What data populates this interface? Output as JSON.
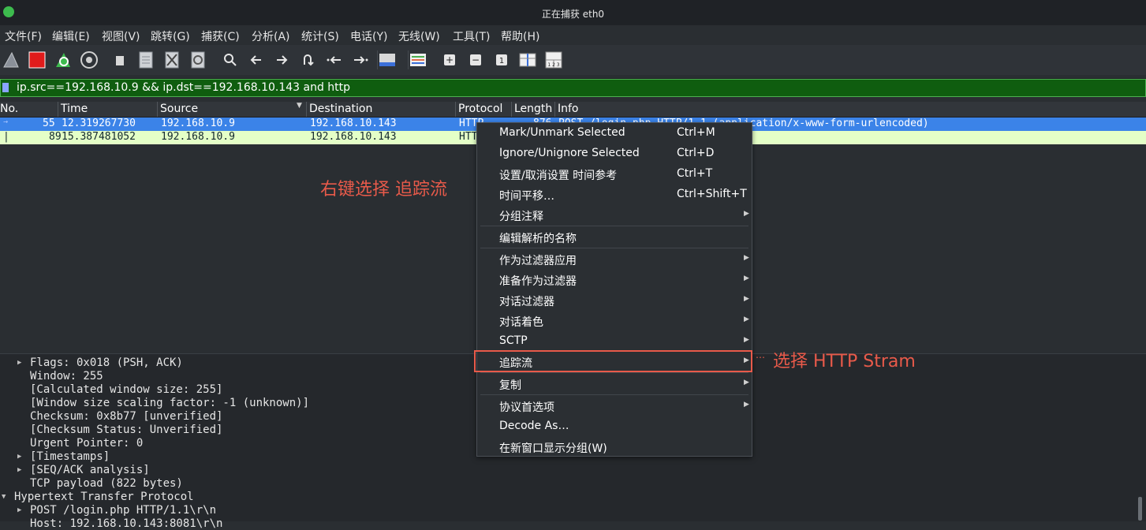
{
  "window": {
    "title": "正在捕获 eth0"
  },
  "menubar": [
    "文件(F)",
    "编辑(E)",
    "视图(V)",
    "跳转(G)",
    "捕获(C)",
    "分析(A)",
    "统计(S)",
    "电话(Y)",
    "无线(W)",
    "工具(T)",
    "帮助(H)"
  ],
  "toolbar": {
    "icons": [
      "shark-fin-icon",
      "stop-capture-icon",
      "restart-capture-icon",
      "capture-options-icon",
      "open-file-icon",
      "save-file-icon",
      "close-file-icon",
      "reload-file-icon",
      "find-packet-icon",
      "go-back-icon",
      "go-forward-icon",
      "go-to-packet-icon",
      "go-first-icon",
      "go-last-icon",
      "auto-scroll-icon",
      "colorize-icon",
      "zoom-in-icon",
      "zoom-out-icon",
      "normal-size-icon",
      "resize-columns-icon",
      "layout-icon"
    ],
    "zoom_in": "+",
    "zoom_out": "−",
    "normal_size": "1",
    "layout_label": "1 2 3"
  },
  "filter": {
    "value": "ip.src==192.168.10.9 && ip.dst==192.168.10.143 and http"
  },
  "columns": [
    "No.",
    "Time",
    "Source",
    "Destination",
    "Protocol",
    "Length",
    "Info"
  ],
  "packets": [
    {
      "no": "55",
      "time": "12.319267730",
      "source": "192.168.10.9",
      "destination": "192.168.10.143",
      "protocol": "HTTP",
      "length": "876",
      "info": "POST /login.php HTTP/1.1  (application/x-www-form-urlencoded)"
    },
    {
      "no": "89",
      "time": "15.387481052",
      "source": "192.168.10.9",
      "destination": "192.168.10.143",
      "protocol": "HTTP",
      "length": "",
      "info": ""
    }
  ],
  "annotations": {
    "right_click": "右键选择 追踪流",
    "select_stream": "选择 HTTP Stram"
  },
  "context_menu": [
    {
      "label": "Mark/Unmark Selected",
      "shortcut": "Ctrl+M"
    },
    {
      "label": "Ignore/Unignore Selected",
      "shortcut": "Ctrl+D"
    },
    {
      "label": "设置/取消设置 时间参考",
      "shortcut": "Ctrl+T"
    },
    {
      "label": "时间平移…",
      "shortcut": "Ctrl+Shift+T"
    },
    {
      "label": "分组注释",
      "submenu": true
    },
    {
      "label": "编辑解析的名称"
    },
    {
      "label": "作为过滤器应用",
      "submenu": true
    },
    {
      "label": "准备作为过滤器",
      "submenu": true
    },
    {
      "label": "对话过滤器",
      "submenu": true
    },
    {
      "label": "对话着色",
      "submenu": true
    },
    {
      "label": "SCTP",
      "submenu": true
    },
    {
      "label": "追踪流",
      "submenu": true,
      "highlighted": true
    },
    {
      "label": "复制",
      "submenu": true
    },
    {
      "label": "协议首选项",
      "submenu": true
    },
    {
      "label": "Decode As…"
    },
    {
      "label": "在新窗口显示分组(W)"
    }
  ],
  "details": [
    {
      "text": "Flags: 0x018 (PSH, ACK)",
      "expandable": true
    },
    {
      "text": "Window: 255"
    },
    {
      "text": "[Calculated window size: 255]"
    },
    {
      "text": "[Window size scaling factor: -1 (unknown)]"
    },
    {
      "text": "Checksum: 0x8b77 [unverified]"
    },
    {
      "text": "[Checksum Status: Unverified]"
    },
    {
      "text": "Urgent Pointer: 0"
    },
    {
      "text": "[Timestamps]",
      "expandable": true
    },
    {
      "text": "[SEQ/ACK analysis]",
      "expandable": true
    },
    {
      "text": "TCP payload (822 bytes)"
    },
    {
      "text": "Hypertext Transfer Protocol",
      "expandable": true,
      "expanded": true,
      "top_level": true
    },
    {
      "text": "POST /login.php HTTP/1.1\\r\\n",
      "expandable": true
    },
    {
      "text": "Host: 192.168.10.143:8081\\r\\n"
    }
  ]
}
